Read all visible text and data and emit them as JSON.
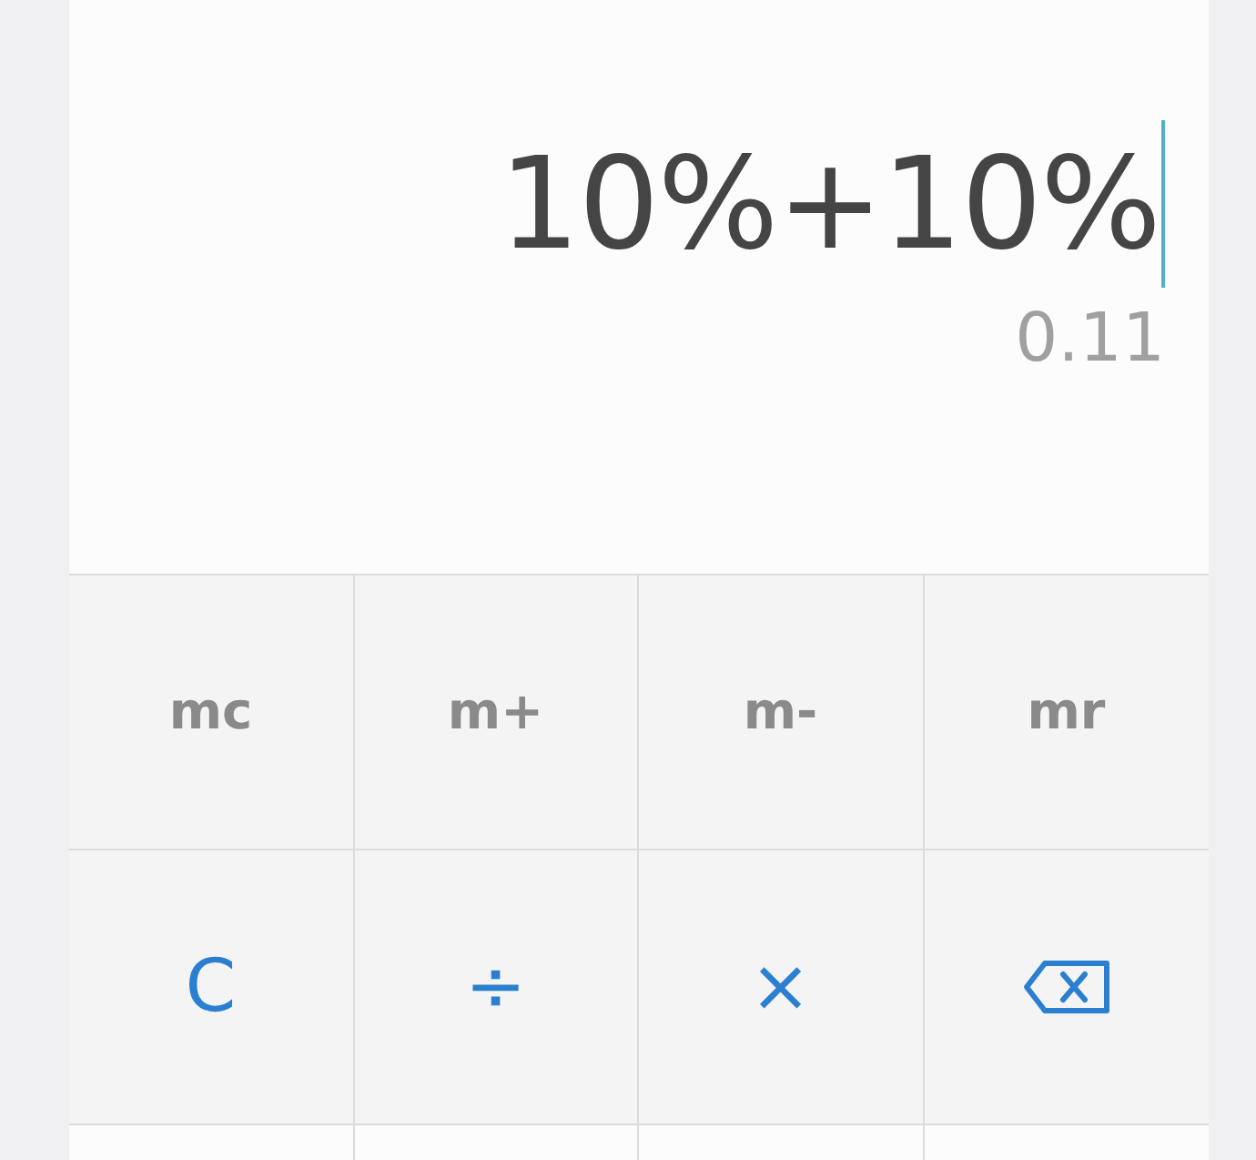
{
  "display": {
    "expression": "10%+10%",
    "result": "0.11"
  },
  "keys": [
    {
      "kind": "memory",
      "label": "mc"
    },
    {
      "kind": "memory",
      "label": "m+"
    },
    {
      "kind": "memory",
      "label": "m-"
    },
    {
      "kind": "memory",
      "label": "mr"
    },
    {
      "kind": "operator",
      "label": "C"
    },
    {
      "kind": "operator",
      "label": "÷"
    },
    {
      "kind": "operator",
      "label": "×"
    },
    {
      "kind": "backspace"
    }
  ]
}
